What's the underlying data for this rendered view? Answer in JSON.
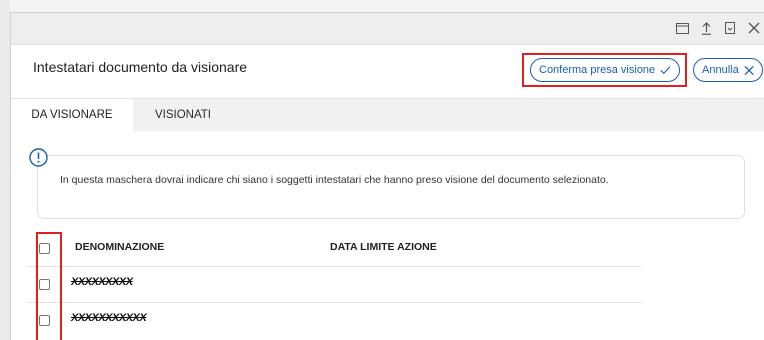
{
  "window": {
    "controls": [
      {
        "name": "restore-window-icon",
        "label": "restore"
      },
      {
        "name": "upload-icon",
        "label": "upload"
      },
      {
        "name": "bookmark-icon",
        "label": "bookmark"
      },
      {
        "name": "close-icon",
        "label": "close"
      }
    ]
  },
  "header": {
    "title": "Intestatari documento da visionare",
    "confirm_label": "Conferma presa visione",
    "cancel_label": "Annulla"
  },
  "tabs": [
    {
      "label": "DA VISIONARE",
      "active": true
    },
    {
      "label": "VISIONATI",
      "active": false
    }
  ],
  "info": {
    "icon": "exclamation-circle-icon",
    "message": "In questa maschera dovrai indicare chi siano i soggetti intestatari che hanno preso visione del documento selezionato."
  },
  "table": {
    "columns": [
      "DENOMINAZIONE",
      "DATA LIMITE AZIONE"
    ],
    "rows": [
      {
        "denominazione": "XXXXXXXXX",
        "data_limite": ""
      },
      {
        "denominazione": "XXXXXXXXXXX",
        "data_limite": ""
      }
    ]
  },
  "colors": {
    "accent": "#1a5fb4",
    "highlight": "#e02020",
    "tab_bar": "#f1f1f1",
    "title_bar": "#eeeeee"
  }
}
